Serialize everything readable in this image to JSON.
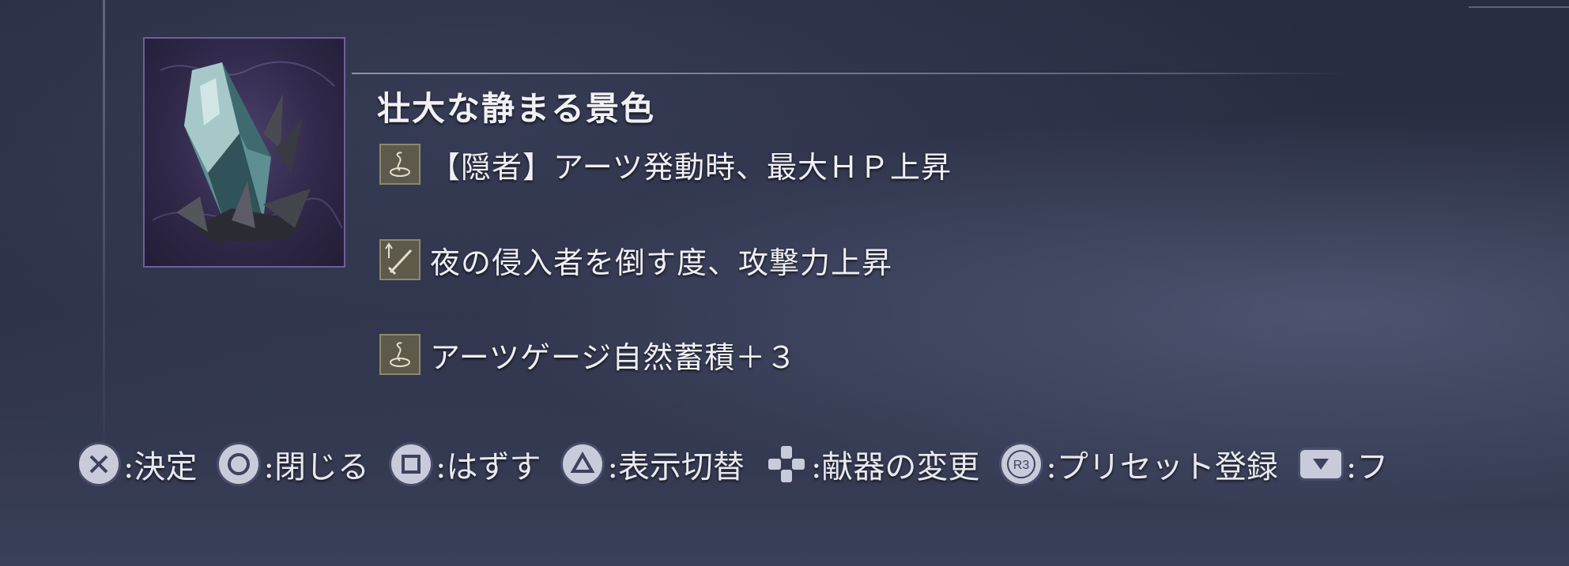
{
  "relic": {
    "name": "壮大な静まる景色",
    "image": "crystal-relic-icon"
  },
  "effects": [
    {
      "icon": "arts-swirl-icon",
      "text": "【隠者】アーツ発動時、最大ＨＰ上昇"
    },
    {
      "icon": "sword-up-icon",
      "text": "夜の侵入者を倒す度、攻撃力上昇"
    },
    {
      "icon": "arts-swirl-icon",
      "text": "アーツゲージ自然蓄積＋３"
    }
  ],
  "controls": [
    {
      "button": "cross-button-icon",
      "label": ":決定"
    },
    {
      "button": "circle-button-icon",
      "label": ":閉じる"
    },
    {
      "button": "square-button-icon",
      "label": ":はずす"
    },
    {
      "button": "triangle-button-icon",
      "label": ":表示切替"
    },
    {
      "button": "dpad-icon",
      "label": ":献器の変更"
    },
    {
      "button": "r3-button-icon",
      "button_text": "R3",
      "label": ":プリセット登録"
    },
    {
      "button": "down-arrow-button-icon",
      "label": ":フ"
    }
  ]
}
